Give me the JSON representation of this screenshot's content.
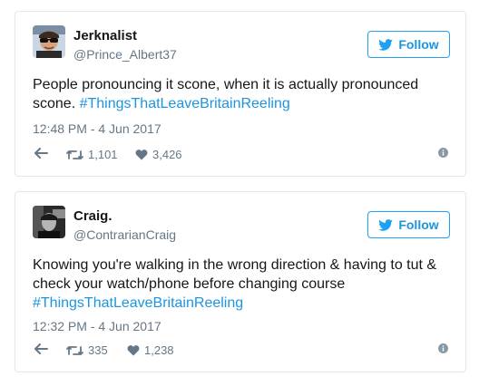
{
  "colors": {
    "accent": "#1b95e0",
    "text": "#14171a",
    "muted": "#657786",
    "border": "#e1e8ed"
  },
  "tweets": [
    {
      "author_name": "Jerknalist",
      "handle": "@Prince_Albert37",
      "follow_label": "Follow",
      "text_main": "People pronouncing it scone, when it is actually pronounced scone. ",
      "hashtag": "#ThingsThatLeaveBritainReeling",
      "timestamp": "12:48 PM - 4 Jun 2017",
      "retweets": "1,101",
      "likes": "3,426",
      "icons": [
        "reply-icon",
        "retweet-icon",
        "heart-icon",
        "info-icon",
        "twitter-bird-icon"
      ]
    },
    {
      "author_name": "Craig.",
      "handle": "@ContrarianCraig",
      "follow_label": "Follow",
      "text_main": "Knowing you're walking in the wrong direction & having to tut & check your watch/phone before changing course ",
      "hashtag": "#ThingsThatLeaveBritainReeling",
      "timestamp": "12:32 PM - 4 Jun 2017",
      "retweets": "335",
      "likes": "1,238",
      "icons": [
        "reply-icon",
        "retweet-icon",
        "heart-icon",
        "info-icon",
        "twitter-bird-icon"
      ]
    }
  ]
}
